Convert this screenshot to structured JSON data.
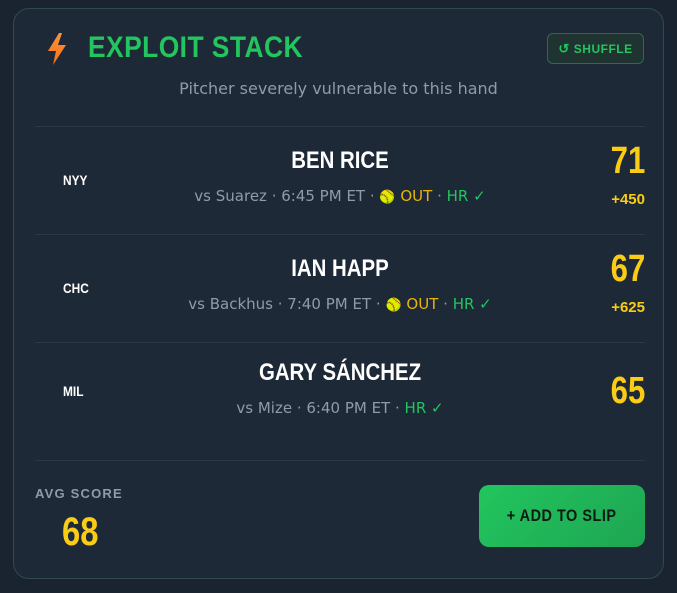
{
  "header": {
    "title": "EXPLOIT STACK",
    "icon": "lightning-bolt-icon",
    "shuffle_icon": "↺",
    "shuffle_label": "SHUFFLE",
    "subtitle": "Pitcher severely vulnerable to this hand"
  },
  "players": [
    {
      "team": "NYY",
      "name": "BEN RICE",
      "opponent": "vs Suarez",
      "time": "6:45 PM ET",
      "ball_icon": "🥎",
      "out": "OUT",
      "hr": "HR ✓",
      "score": "71",
      "odds": "+450"
    },
    {
      "team": "CHC",
      "name": "IAN HAPP",
      "opponent": "vs Backhus",
      "time": "7:40 PM ET",
      "ball_icon": "🥎",
      "out": "OUT",
      "hr": "HR ✓",
      "score": "67",
      "odds": "+625"
    },
    {
      "team": "MIL",
      "name": "GARY SÁNCHEZ",
      "opponent": "vs Mize",
      "time": "6:40 PM ET",
      "hr": "HR ✓",
      "score": "65"
    }
  ],
  "footer": {
    "avg_label": "AVG SCORE",
    "avg_value": "68",
    "add_button_label": "+ ADD TO SLIP"
  },
  "colors": {
    "accent_green": "#22c55e",
    "accent_yellow": "#facc15",
    "bolt_orange": "#f97316",
    "card_bg": "#1e2938"
  }
}
